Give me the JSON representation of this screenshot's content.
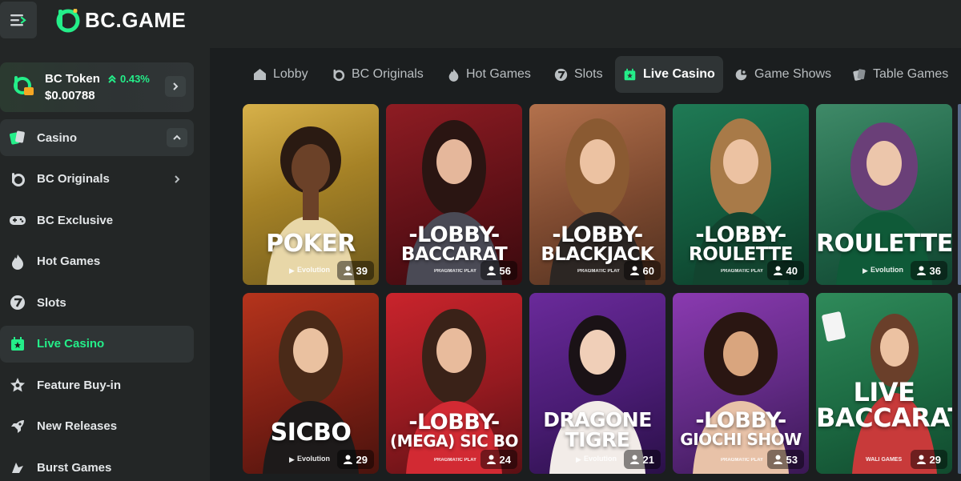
{
  "header": {
    "logo_text": "BC.GAME",
    "menu_icon": "menu-collapse-icon"
  },
  "token": {
    "name": "BC Token",
    "change": "0.43%",
    "price": "$0.00788",
    "change_color": "#24ee89"
  },
  "sidebar": {
    "items": [
      {
        "label": "Casino",
        "icon": "cards-icon"
      },
      {
        "label": "BC Originals",
        "icon": "bc-originals-icon"
      },
      {
        "label": "BC Exclusive",
        "icon": "gamepad-icon"
      },
      {
        "label": "Hot Games",
        "icon": "fire-icon"
      },
      {
        "label": "Slots",
        "icon": "slot-seven-icon"
      },
      {
        "label": "Live Casino",
        "icon": "live-casino-icon"
      },
      {
        "label": "Feature Buy-in",
        "icon": "star-icon"
      },
      {
        "label": "New Releases",
        "icon": "rocket-icon"
      },
      {
        "label": "Burst Games",
        "icon": "burst-icon"
      }
    ]
  },
  "tabs": [
    {
      "label": "Lobby",
      "icon": "home-icon"
    },
    {
      "label": "BC Originals",
      "icon": "bc-originals-icon"
    },
    {
      "label": "Hot Games",
      "icon": "fire-icon"
    },
    {
      "label": "Slots",
      "icon": "slot-seven-icon"
    },
    {
      "label": "Live Casino",
      "icon": "live-casino-icon",
      "active": true
    },
    {
      "label": "Game Shows",
      "icon": "game-show-icon"
    },
    {
      "label": "Table Games",
      "icon": "table-cards-icon"
    }
  ],
  "games": [
    {
      "line1": "POKER",
      "line2": "",
      "provider": "Evolution",
      "players": "39"
    },
    {
      "line1": "-LOBBY-",
      "line2": "BACCARAT",
      "provider": "PRAGMATIC PLAY",
      "players": "56"
    },
    {
      "line1": "-LOBBY-",
      "line2": "BLACKJACK",
      "provider": "PRAGMATIC PLAY",
      "players": "60"
    },
    {
      "line1": "-LOBBY-",
      "line2": "ROULETTE",
      "provider": "PRAGMATIC PLAY",
      "players": "40"
    },
    {
      "line1": "ROULETTE",
      "line2": "",
      "provider": "Evolution",
      "players": "36"
    },
    {
      "line1": "SICBO",
      "line2": "",
      "provider": "Evolution",
      "players": "29"
    },
    {
      "line1": "-LOBBY-",
      "line2": "(MEGA) SIC BO",
      "provider": "PRAGMATIC PLAY",
      "players": "24"
    },
    {
      "line1": "DRAGONE",
      "line2": "TIGRE",
      "provider": "Evolution",
      "players": "21"
    },
    {
      "line1": "-LOBBY-",
      "line2": "GIOCHI SHOW",
      "provider": "PRAGMATIC PLAY",
      "players": "53"
    },
    {
      "line1": "LIVE",
      "line2": "BACCARAT",
      "provider": "WALI GAMES",
      "players": "29"
    }
  ],
  "colors": {
    "accent": "#24ee89",
    "sidebar_bg": "#232626",
    "main_bg": "#1b1e1f"
  }
}
